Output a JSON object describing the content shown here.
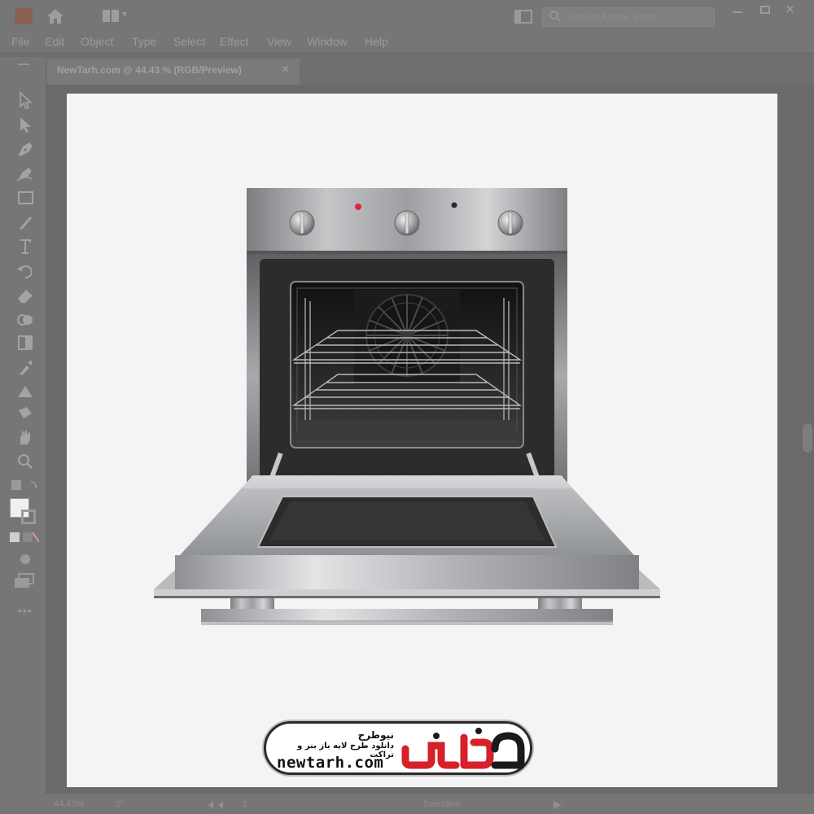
{
  "app": {
    "search_placeholder": "Search Adobe Stock"
  },
  "menu": [
    "File",
    "Edit",
    "Object",
    "Type",
    "Select",
    "Effect",
    "View",
    "Window",
    "Help"
  ],
  "document_tab": {
    "title": "NewTarh.com @ 44.43 % (RGB/Preview)",
    "close": "×"
  },
  "tools": [
    "selection-tool-icon",
    "direct-selection-tool-icon",
    "pen-tool-icon",
    "curvature-tool-icon",
    "rectangle-tool-icon",
    "paintbrush-tool-icon",
    "type-tool-icon",
    "rotate-tool-icon",
    "eraser-tool-icon",
    "shape-builder-tool-icon",
    "gradient-tool-icon",
    "eyedropper-tool-icon",
    "blend-tool-icon",
    "artboard-tool-icon",
    "hand-tool-icon",
    "zoom-tool-icon"
  ],
  "statusbar": {
    "zoom": "44.43%",
    "rotate": "0°",
    "artboard": "1",
    "tool": "Selection"
  },
  "watermark": {
    "brand": "نیوطرح",
    "tagline": "دانلود طرح لایه باز بنر و تراکت",
    "domain": "newtarh.com",
    "mark_text": "نیوطرح",
    "accent": "#d6202a"
  },
  "colors": {
    "chrome": "#767676",
    "artboard": "#f4f4f4",
    "oven_steel": "#a9abad",
    "oven_cavity": "#1a1a1a",
    "indicator_light": "#e0283a"
  }
}
